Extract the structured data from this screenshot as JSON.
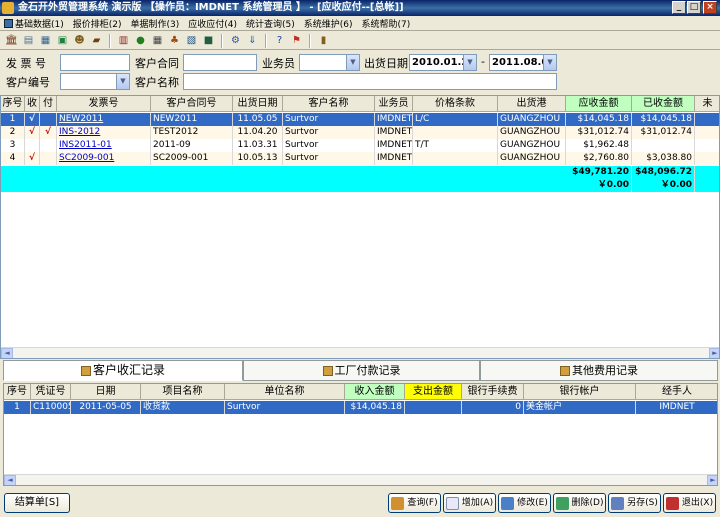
{
  "window": {
    "title": "金石开外贸管理系统 演示版 【操作员：IMDNET 系统管理员 】 - [应收应付--[总帐]]"
  },
  "menu": [
    "基础数据(1)",
    "报价排柜(2)",
    "单据制作(3)",
    "应收应付(4)",
    "统计查询(5)",
    "系统维护(6)",
    "系统帮助(7)"
  ],
  "filters": {
    "invoice_label": "发 票 号",
    "invoice_value": "",
    "contract_label": "客户合同",
    "contract_value": "",
    "salesman_label": "业务员",
    "salesman_value": "",
    "ship_date_label": "出货日期",
    "date_from": "2010.01.26",
    "date_sep": "-",
    "date_to": "2011.08.09",
    "customer_no_label": "客户编号",
    "customer_no_value": "",
    "customer_name_label": "客户名称",
    "customer_name_value": ""
  },
  "main_table": {
    "headers": [
      "序号",
      "收",
      "付",
      "发票号",
      "客户合同号",
      "出货日期",
      "客户名称",
      "业务员",
      "价格条款",
      "出货港",
      "应收金额",
      "已收金额",
      "未"
    ],
    "rows": [
      {
        "no": "1",
        "rcv": "√",
        "pay": "",
        "invoice": "NEW2011",
        "contract": "NEW2011",
        "date": "11.05.05",
        "customer": "Surtvor",
        "sales": "IMDNET",
        "terms": "L/C",
        "port": "GUANGZHOU",
        "receivable": "$14,045.18",
        "received": "$14,045.18"
      },
      {
        "no": "2",
        "rcv": "√",
        "pay": "√",
        "invoice": "INS-2012",
        "contract": "TEST2012",
        "date": "11.04.20",
        "customer": "Surtvor",
        "sales": "IMDNET",
        "terms": "",
        "port": "GUANGZHOU",
        "receivable": "$31,012.74",
        "received": "$31,012.74"
      },
      {
        "no": "3",
        "rcv": "",
        "pay": "",
        "invoice": "INS2011-01",
        "contract": "2011-09",
        "date": "11.03.31",
        "customer": "Surtvor",
        "sales": "IMDNET",
        "terms": "T/T",
        "port": "GUANGZHOU",
        "receivable": "$1,962.48",
        "received": ""
      },
      {
        "no": "4",
        "rcv": "√",
        "pay": "",
        "invoice": "SC2009-001",
        "contract": "SC2009-001",
        "date": "10.05.13",
        "customer": "Surtvor",
        "sales": "IMDNET",
        "terms": "",
        "port": "GUANGZHOU",
        "receivable": "$2,760.80",
        "received": "$3,038.80"
      }
    ],
    "totals": {
      "receivable_usd": "$49,781.20",
      "received_usd": "$48,096.72",
      "receivable_cny": "￥0.00",
      "received_cny": "￥0.00"
    }
  },
  "tabs": [
    {
      "label": "客户收汇记录",
      "active": true
    },
    {
      "label": "工厂付款记录",
      "active": false
    },
    {
      "label": "其他费用记录",
      "active": false
    }
  ],
  "detail_table": {
    "headers": [
      "序号",
      "凭证号",
      "日期",
      "项目名称",
      "单位名称",
      "收入金额",
      "支出金额",
      "银行手续费",
      "银行帐户",
      "经手人"
    ],
    "rows": [
      {
        "no": "1",
        "voucher": "C110005",
        "date": "2011-05-05",
        "item": "收货款",
        "unit": "Surtvor",
        "income": "$14,045.18",
        "expense": "",
        "fee": "0",
        "account": "美金帐户",
        "handler": "IMDNET"
      }
    ]
  },
  "buttons": {
    "settle": "结算单[S]",
    "query": "查询(F)",
    "add": "增加(A)",
    "edit": "修改(E)",
    "delete": "删除(D)",
    "saveas": "另存(S)",
    "exit": "退出(X)"
  },
  "colors": {
    "selection": "#316ac5",
    "totals_bg": "#00ffff",
    "receivable_header": "#c0ffc0",
    "expense_header": "#ffff00"
  }
}
